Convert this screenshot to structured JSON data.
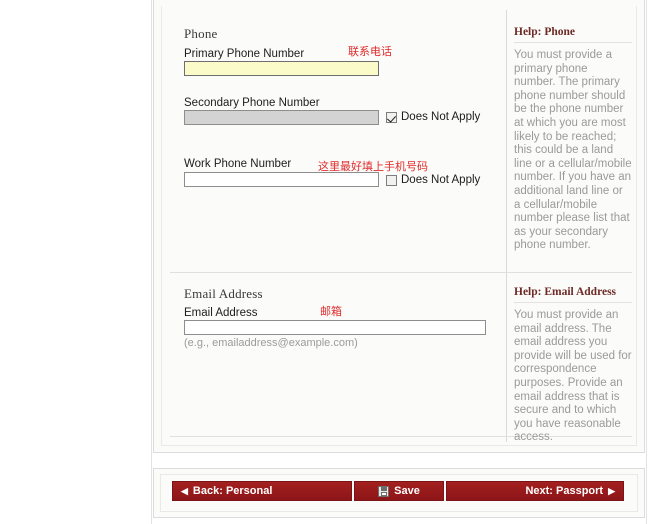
{
  "form": {
    "phone_section": {
      "title": "Phone",
      "primary": {
        "label": "Primary Phone Number",
        "value": "",
        "annotation": "联系电话"
      },
      "secondary": {
        "label": "Secondary Phone Number",
        "value": "",
        "checkbox_label": "Does Not Apply",
        "checked": true
      },
      "work": {
        "label": "Work Phone Number",
        "value": "",
        "checkbox_label": "Does Not Apply",
        "checked": false,
        "annotation": "这里最好填上手机号码"
      }
    },
    "email_section": {
      "title": "Email Address",
      "email": {
        "label": "Email Address",
        "value": "",
        "annotation": "邮箱",
        "hint": "(e.g., emailaddress@example.com)"
      }
    }
  },
  "help": {
    "phone": {
      "title": "Help: Phone",
      "body": "You must provide a primary phone number. The primary phone number should be the phone number at which you are most likely to be reached; this could be a land line or a cellular/mobile number. If you have an additional land line or a cellular/mobile number please list that as your secondary phone number."
    },
    "email": {
      "title": "Help: Email Address",
      "body": "You must provide an email address.  The email address you provide will be used for correspondence purposes.  Provide an email address that is secure and to which you have reasonable access."
    }
  },
  "nav": {
    "back_label": "Back: Personal",
    "back_arrow": "◀",
    "save_label": "Save",
    "save_icon": "floppy-disk-icon",
    "next_label": "Next: Passport",
    "next_arrow": "▶"
  },
  "colors": {
    "brand_red": "#a3201f",
    "help_heading": "#6e2b26",
    "annotation_red": "#e02b2b",
    "focused_field": "#fbfbca",
    "disabled_field": "#d3d3d3"
  }
}
